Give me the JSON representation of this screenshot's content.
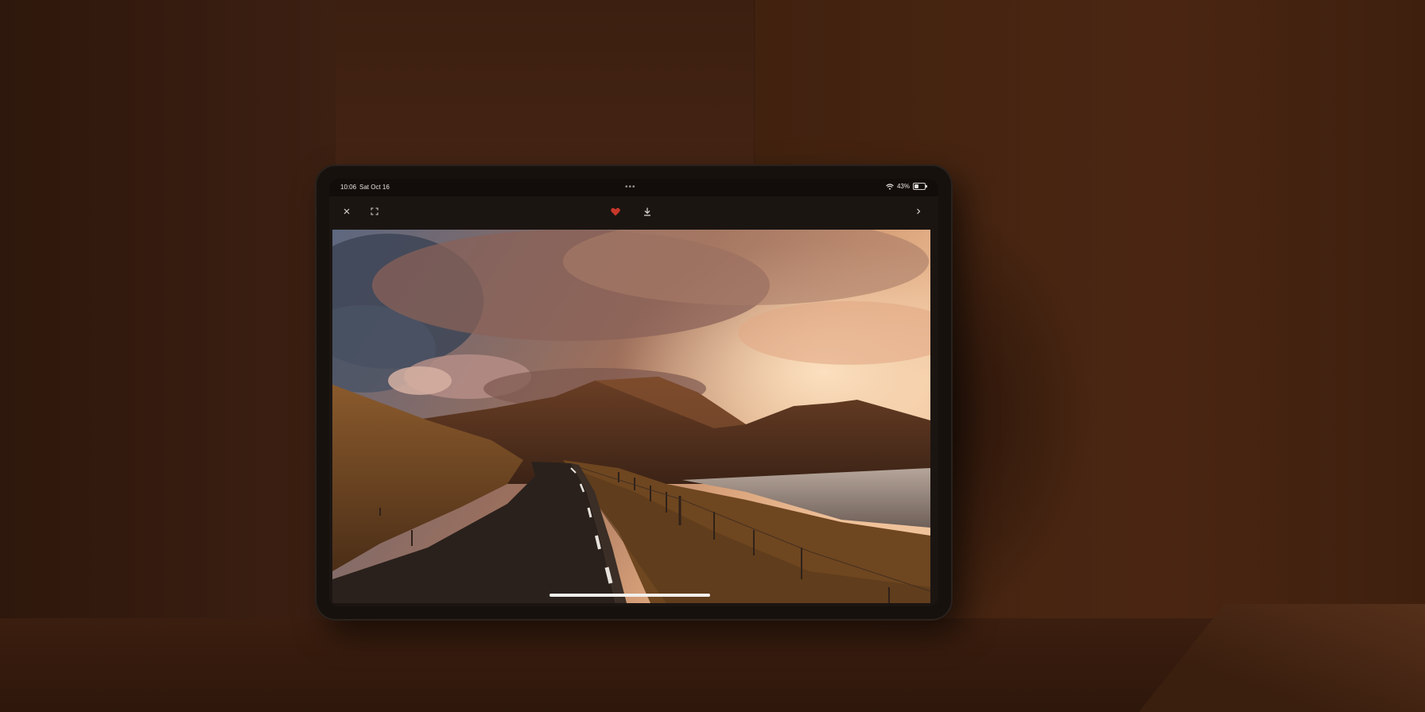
{
  "status_bar": {
    "time": "10:06",
    "date": "Sat Oct 16",
    "multitask": "•••",
    "battery_percent": "43%",
    "battery_level": 0.43
  },
  "toolbar": {
    "close_icon": "close-icon",
    "fullscreen_icon": "fullscreen-icon",
    "like_icon": "heart-icon",
    "like_color": "#c7372a",
    "download_icon": "download-icon",
    "next_icon": "chevron-right-icon"
  },
  "photo": {
    "subject": "mountain-road-sunset-photo"
  }
}
